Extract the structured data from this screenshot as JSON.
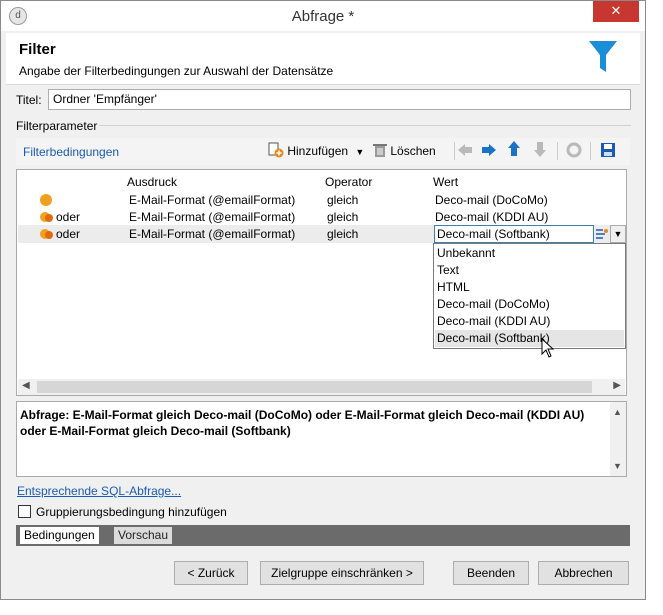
{
  "window": {
    "title": "Abfrage *",
    "close_glyph": "✕",
    "minimize_glyph": "—",
    "maximize_glyph": "☐"
  },
  "header": {
    "title": "Filter",
    "subtitle": "Angabe der Filterbedingungen zur Auswahl der Datensätze",
    "icon": "funnel-icon",
    "accent": "#1a8fd8"
  },
  "titel": {
    "label": "Titel:",
    "value": "Ordner 'Empfänger'"
  },
  "filterparameter": {
    "label": "Filterparameter"
  },
  "toolbar": {
    "link": "Filterbedingungen",
    "add_label": "Hinzufügen",
    "delete_label": "Löschen"
  },
  "grid": {
    "columns": [
      "Ausdruck",
      "Operator",
      "Wert"
    ],
    "rows": [
      {
        "logic": "",
        "expression": "E-Mail-Format (@emailFormat)",
        "operator": "gleich",
        "value": "Deco-mail (DoCoMo)"
      },
      {
        "logic": "oder",
        "expression": "E-Mail-Format (@emailFormat)",
        "operator": "gleich",
        "value": "Deco-mail (KDDI AU)"
      },
      {
        "logic": "oder",
        "expression": "E-Mail-Format (@emailFormat)",
        "operator": "gleich",
        "value": "Deco-mail (Softbank)"
      }
    ],
    "dropdown_options": [
      "Unbekannt",
      "Text",
      "HTML",
      "Deco-mail (DoCoMo)",
      "Deco-mail (KDDI AU)",
      "Deco-mail (Softbank)"
    ],
    "dropdown_selected": "Deco-mail (Softbank)"
  },
  "query_text": "Abfrage: E-Mail-Format gleich Deco-mail (DoCoMo) oder E-Mail-Format gleich Deco-mail (KDDI AU) oder E-Mail-Format gleich Deco-mail (Softbank)",
  "sql_link": "Entsprechende SQL-Abfrage...",
  "grouping_checkbox": {
    "label": "Gruppierungsbedingung hinzufügen",
    "checked": false
  },
  "tabs": [
    "Bedingungen",
    "Vorschau"
  ],
  "buttons": {
    "back": "< Zurück",
    "restrict": "Zielgruppe einschränken >",
    "finish": "Beenden",
    "cancel": "Abbrechen"
  }
}
